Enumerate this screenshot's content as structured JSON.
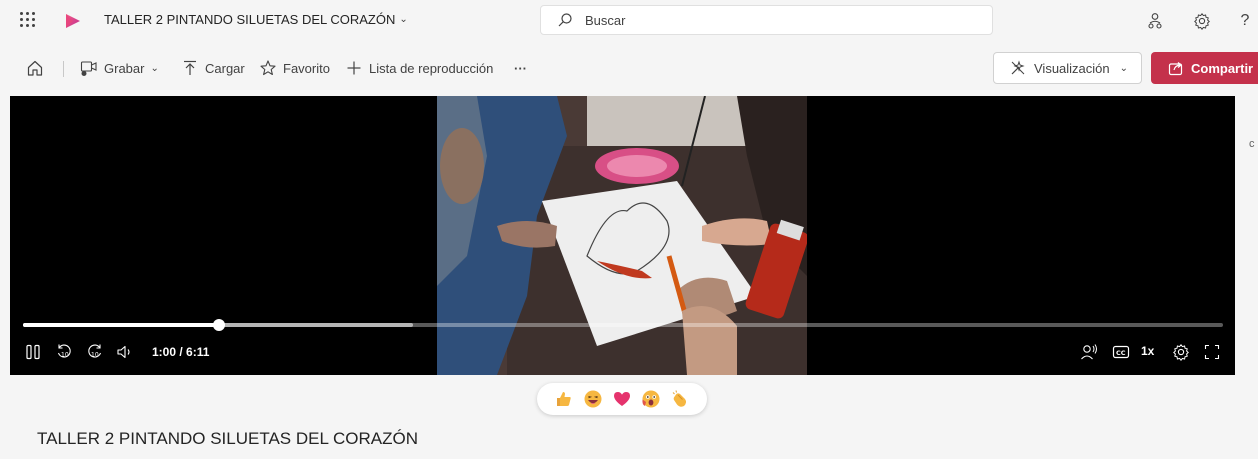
{
  "header": {
    "video_title": "TALLER 2 PINTANDO SILUETAS DEL CORAZÓN",
    "search_placeholder": "Buscar",
    "help_label": "?"
  },
  "commands": {
    "record": "Grabar",
    "upload": "Cargar",
    "favorite": "Favorito",
    "playlist": "Lista de reproducción",
    "more": "···",
    "view": "Visualización",
    "share": "Compartir"
  },
  "player": {
    "current_time": "1:00",
    "duration": "6:11",
    "time_display": "1:00 / 6:11",
    "speed": "1x",
    "progress": 0.163,
    "buffered": 0.325,
    "side_hint": "c"
  },
  "page": {
    "title": "TALLER 2 PINTANDO SILUETAS DEL CORAZÓN"
  },
  "colors": {
    "share_button": "#c4314b",
    "background": "#f5f5f5",
    "player_background": "#000000"
  },
  "icons": [
    "app-launcher-icon",
    "stream-logo-icon",
    "search-icon",
    "people-icon",
    "settings-icon",
    "home-icon",
    "record-icon",
    "upload-icon",
    "star-icon",
    "add-icon",
    "view-icon",
    "share-icon",
    "pause-icon",
    "rewind-10-icon",
    "forward-10-icon",
    "volume-icon",
    "speaker-person-icon",
    "captions-icon",
    "player-settings-icon",
    "fullscreen-icon"
  ],
  "reactions": [
    "thumbs-up",
    "laugh",
    "heart",
    "surprised",
    "clap"
  ]
}
